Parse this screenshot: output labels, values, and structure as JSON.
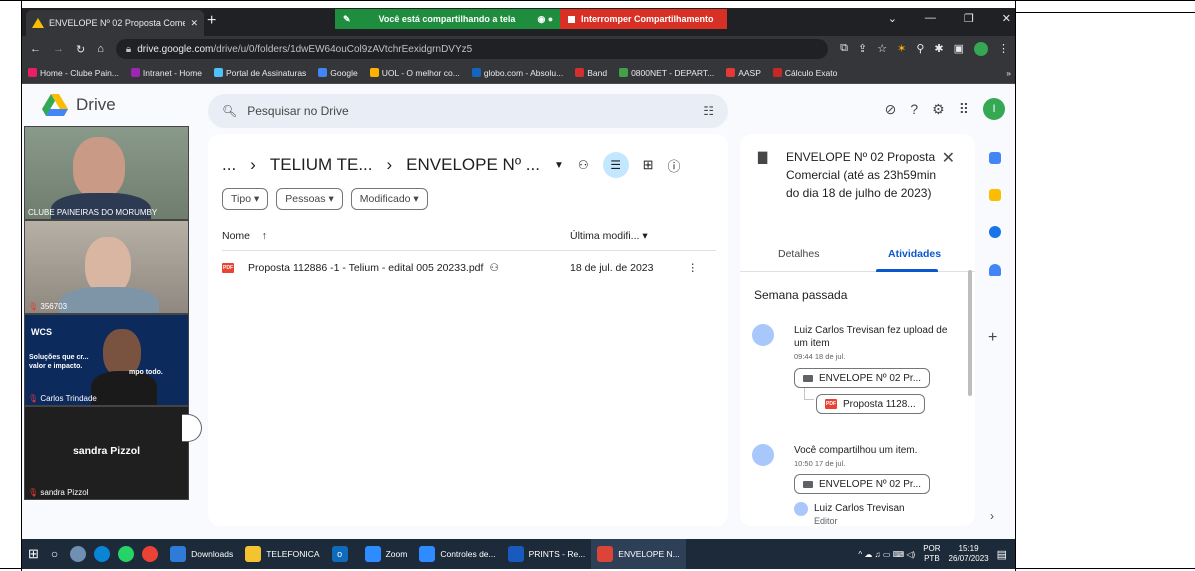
{
  "browser": {
    "tab_title": "ENVELOPE Nº 02 Proposta Come",
    "share_notice": "Você está compartilhando a tela",
    "stop_sharing": "Interromper Compartilhamento",
    "url_host": "drive.google.com",
    "url_path": "/drive/u/0/folders/1dwEW64ouCol9zAVtchrEexidgrnDVYz5",
    "bookmarks": [
      {
        "label": "Home - Clube Pain...",
        "color": "#e91e63"
      },
      {
        "label": "Intranet - Home",
        "color": "#9c27b0"
      },
      {
        "label": "Portal de Assinaturas",
        "color": "#4fc3f7"
      },
      {
        "label": "Google",
        "color": "#4285f4"
      },
      {
        "label": "UOL - O melhor co...",
        "color": "#ffb300"
      },
      {
        "label": "globo.com - Absolu...",
        "color": "#1565c0"
      },
      {
        "label": "Band",
        "color": "#d32f2f"
      },
      {
        "label": "0800NET - DEPART...",
        "color": "#43a047"
      },
      {
        "label": "AASP",
        "color": "#e53935"
      },
      {
        "label": "Cálculo Exato",
        "color": "#c62828"
      }
    ],
    "bookmarks_more": "»"
  },
  "drive": {
    "app_name": "Drive",
    "search_placeholder": "Pesquisar no Drive",
    "avatar_letter": "I",
    "breadcrumb": {
      "ellipsis": "...",
      "parent": "TELIUM TE...",
      "current": "ENVELOPE Nº ..."
    },
    "filters": [
      "Tipo",
      "Pessoas",
      "Modificado"
    ],
    "list": {
      "name_header": "Nome",
      "modified_header": "Última modifi...",
      "files": [
        {
          "name": "Proposta 112886 -1 - Telium - edital 005 20233.pdf",
          "modified": "18 de jul. de 2023",
          "type": "PDF"
        }
      ]
    }
  },
  "details_panel": {
    "title": "ENVELOPE Nº 02 Proposta Comercial (até as 23h59min do dia 18 de julho de 2023)",
    "tabs": [
      "Detalhes",
      "Atividades"
    ],
    "active_tab": "Atividades",
    "period": "Semana passada",
    "activities": [
      {
        "text": "Luiz Carlos Trevisan fez upload de um item",
        "time": "09:44 18 de jul.",
        "folder": "ENVELOPE Nº 02 Pr...",
        "file": "Proposta 1128..."
      },
      {
        "text": "Você compartilhou um item.",
        "time": "10:50 17 de jul.",
        "folder": "ENVELOPE Nº 02 Pr...",
        "person": "Luiz Carlos Trevisan",
        "role": "Editor"
      }
    ]
  },
  "meeting": {
    "participants": [
      "CLUBE PAINEIRAS DO MORUMBY",
      "356703",
      "Carlos Trindade",
      "sandra Pizzol"
    ],
    "featured_name": "sandra Pizzol",
    "banner_brand": "WCS",
    "banner_text": "Soluções que cr... valor e impacto.",
    "banner_tail": "mpo todo."
  },
  "taskbar": {
    "apps": [
      {
        "label": "Downloads",
        "color": "#2f7bd8"
      },
      {
        "label": "TELEFONICA",
        "color": "#f4c430"
      },
      {
        "label": "",
        "color": "#0f6cbd",
        "badge": "o"
      },
      {
        "label": "Zoom",
        "color": "#2d8cff"
      },
      {
        "label": "Controles de...",
        "color": "#2d8cff"
      },
      {
        "label": "PRINTS - Re...",
        "color": "#185abd"
      },
      {
        "label": "ENVELOPE N...",
        "color": "#db4437"
      }
    ],
    "lang_top": "POR",
    "lang_bottom": "PTB",
    "time": "15:19",
    "date": "26/07/2023"
  }
}
